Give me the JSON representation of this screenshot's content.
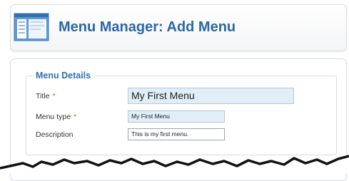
{
  "header": {
    "title": "Menu Manager: Add Menu",
    "icon": "menu-manager-icon"
  },
  "form": {
    "legend": "Menu Details",
    "required_marker": "*",
    "fields": [
      {
        "label": "Title",
        "value": "My First Menu",
        "required": true
      },
      {
        "label": "Menu type",
        "value": "My First Menu",
        "required": true
      },
      {
        "label": "Description",
        "value": "This is my first menu.",
        "required": false
      }
    ]
  },
  "colors": {
    "title": "#2b67a8",
    "legend": "#2f6fb3",
    "required": "#e2612f",
    "filled_input_bg": "#dfeef7"
  }
}
